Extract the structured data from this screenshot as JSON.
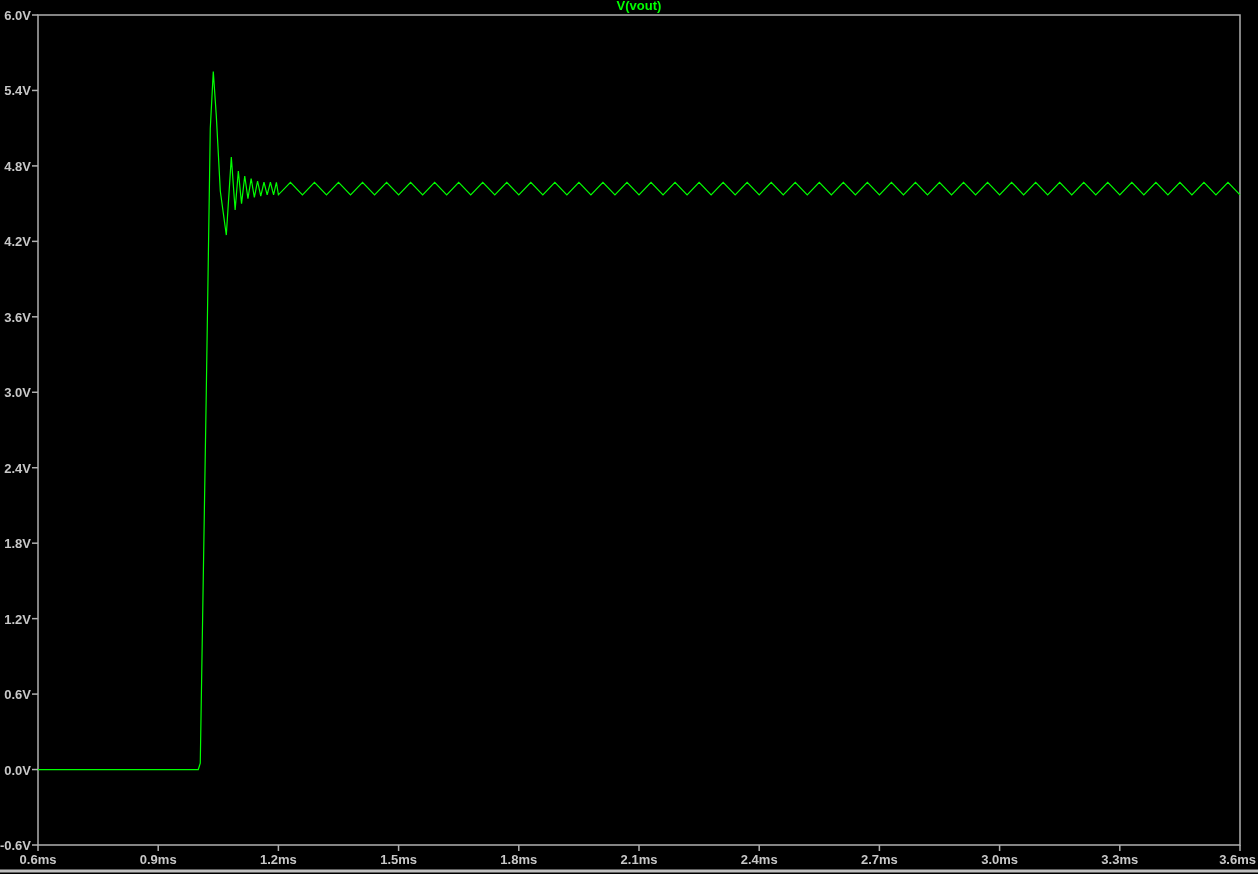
{
  "chart_data": {
    "type": "line",
    "xticks": [
      {
        "value": 0.6,
        "label": "0.6ms"
      },
      {
        "value": 0.9,
        "label": "0.9ms"
      },
      {
        "value": 1.2,
        "label": "1.2ms"
      },
      {
        "value": 1.5,
        "label": "1.5ms"
      },
      {
        "value": 1.8,
        "label": "1.8ms"
      },
      {
        "value": 2.1,
        "label": "2.1ms"
      },
      {
        "value": 2.4,
        "label": "2.4ms"
      },
      {
        "value": 2.7,
        "label": "2.7ms"
      },
      {
        "value": 3.0,
        "label": "3.0ms"
      },
      {
        "value": 3.3,
        "label": "3.3ms"
      },
      {
        "value": 3.6,
        "label": "3.6ms"
      }
    ],
    "yticks": [
      {
        "value": 6.0,
        "label": "6.0V"
      },
      {
        "value": 5.4,
        "label": "5.4V"
      },
      {
        "value": 4.8,
        "label": "4.8V"
      },
      {
        "value": 4.2,
        "label": "4.2V"
      },
      {
        "value": 3.6,
        "label": "3.6V"
      },
      {
        "value": 3.0,
        "label": "3.0V"
      },
      {
        "value": 2.4,
        "label": "2.4V"
      },
      {
        "value": 1.8,
        "label": "1.8V"
      },
      {
        "value": 1.2,
        "label": "1.2V"
      },
      {
        "value": 0.6,
        "label": "0.6V"
      },
      {
        "value": 0.0,
        "label": "0.0V"
      },
      {
        "value": -0.6,
        "label": "-0.6V"
      }
    ],
    "xlim": [
      0.6,
      3.6
    ],
    "ylim": [
      -0.6,
      6.0
    ],
    "x": [
      0.6,
      1.0,
      1.005,
      1.02,
      1.03,
      1.0375,
      1.045,
      1.055,
      1.07,
      1.0825,
      1.092,
      1.1,
      1.108,
      1.116,
      1.124,
      1.132,
      1.14,
      1.148,
      1.156,
      1.164,
      1.172,
      1.18,
      1.188,
      1.195,
      1.2,
      1.23,
      1.26,
      1.29,
      1.32,
      1.35,
      1.38,
      1.41,
      1.44,
      1.47,
      1.5,
      1.53,
      1.56,
      1.59,
      1.62,
      1.65,
      1.68,
      1.71,
      1.74,
      1.77,
      1.8,
      1.83,
      1.86,
      1.89,
      1.92,
      1.95,
      1.98,
      2.01,
      2.04,
      2.07,
      2.1,
      2.13,
      2.16,
      2.19,
      2.22,
      2.25,
      2.28,
      2.31,
      2.34,
      2.37,
      2.4,
      2.43,
      2.46,
      2.49,
      2.52,
      2.55,
      2.58,
      2.61,
      2.64,
      2.67,
      2.7,
      2.73,
      2.76,
      2.79,
      2.82,
      2.85,
      2.88,
      2.91,
      2.94,
      2.97,
      3.0,
      3.03,
      3.06,
      3.09,
      3.12,
      3.15,
      3.18,
      3.21,
      3.24,
      3.27,
      3.3,
      3.33,
      3.36,
      3.39,
      3.42,
      3.45,
      3.48,
      3.51,
      3.54,
      3.57,
      3.6
    ],
    "series": [
      {
        "name": "V(vout)",
        "color": "#00ff00",
        "values": [
          0,
          0,
          0.05,
          3.0,
          5.1,
          5.55,
          5.2,
          4.6,
          4.25,
          4.87,
          4.45,
          4.76,
          4.5,
          4.72,
          4.54,
          4.7,
          4.55,
          4.68,
          4.56,
          4.67,
          4.57,
          4.67,
          4.57,
          4.67,
          4.57,
          4.67,
          4.57,
          4.67,
          4.57,
          4.67,
          4.57,
          4.67,
          4.57,
          4.67,
          4.57,
          4.67,
          4.57,
          4.67,
          4.57,
          4.67,
          4.57,
          4.67,
          4.57,
          4.67,
          4.57,
          4.67,
          4.57,
          4.67,
          4.57,
          4.67,
          4.57,
          4.67,
          4.57,
          4.67,
          4.57,
          4.67,
          4.57,
          4.67,
          4.57,
          4.67,
          4.57,
          4.67,
          4.57,
          4.67,
          4.57,
          4.67,
          4.57,
          4.67,
          4.57,
          4.67,
          4.57,
          4.67,
          4.57,
          4.67,
          4.57,
          4.67,
          4.57,
          4.67,
          4.57,
          4.67,
          4.57,
          4.67,
          4.57,
          4.67,
          4.57,
          4.67,
          4.57,
          4.67,
          4.57,
          4.67,
          4.57,
          4.67,
          4.57,
          4.67,
          4.57,
          4.67,
          4.57,
          4.67,
          4.57,
          4.67,
          4.57,
          4.67,
          4.57,
          4.67,
          4.57
        ]
      }
    ]
  }
}
